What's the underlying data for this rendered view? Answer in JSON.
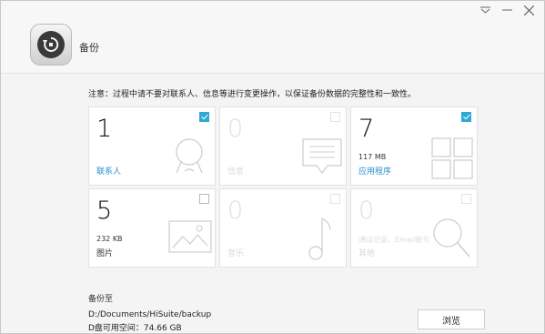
{
  "window": {
    "title": "备份",
    "controls": [
      "dropdown-icon",
      "minimize-icon",
      "close-icon"
    ]
  },
  "notice": "注意：过程中请不要对联系人、信息等进行变更操作，以保证备份数据的完整性和一致性。",
  "cards": [
    {
      "count": "1",
      "size": "",
      "label": "联系人",
      "checked": true,
      "enabled": true,
      "icon": "contact-icon"
    },
    {
      "count": "0",
      "size": "",
      "label": "信息",
      "checked": false,
      "enabled": false,
      "icon": "message-icon"
    },
    {
      "count": "7",
      "size": "117 MB",
      "label": "应用程序",
      "checked": true,
      "enabled": true,
      "icon": "apps-icon"
    },
    {
      "count": "5",
      "size": "232 KB",
      "label": "图片",
      "checked": false,
      "enabled": true,
      "icon": "image-icon"
    },
    {
      "count": "0",
      "size": "",
      "label": "音乐",
      "checked": false,
      "enabled": false,
      "icon": "music-icon"
    },
    {
      "count": "0",
      "size": "",
      "label": "其他",
      "sublabel": "通话记录、Email帐号",
      "checked": false,
      "enabled": false,
      "icon": "search-icon"
    }
  ],
  "backup_to_label": "备份至",
  "path": "D:/Documents/HiSuite/backup",
  "free_space": "D盘可用空间：74.66 GB",
  "browse_label": "浏览",
  "colors": {
    "accent": "#2ea9d6",
    "label_blue": "#2e8fcf"
  }
}
